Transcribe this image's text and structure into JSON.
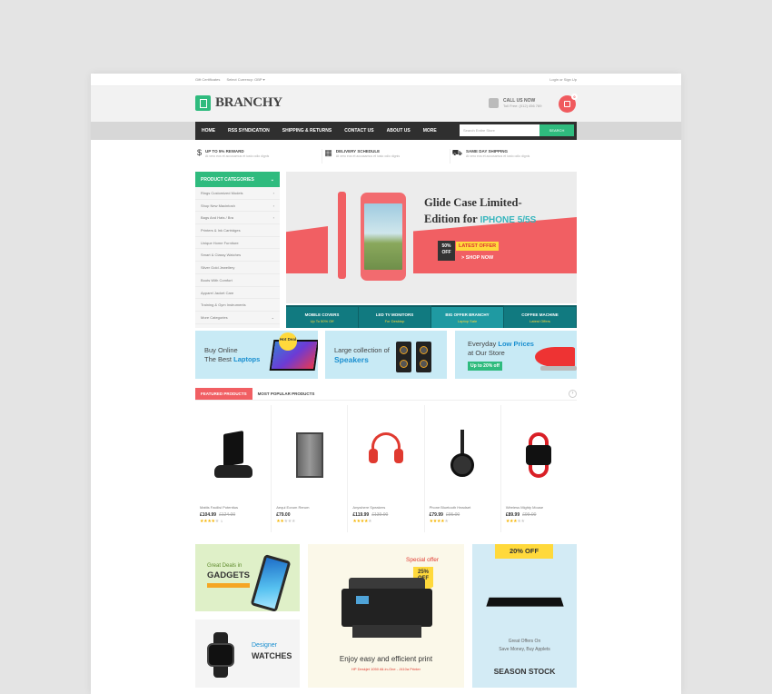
{
  "topbar": {
    "gift": "Gift Certificates",
    "currency": "Select Currency: GBP ▾",
    "login": "Login or Sign Up"
  },
  "header": {
    "logo": "BRANCHY",
    "call_title": "CALL US NOW",
    "call_sub": "Toll Free: (012) 456 789",
    "cart_count": "0"
  },
  "nav": {
    "items": [
      "HOME",
      "RSS SYNDICATION",
      "SHIPPING & RETURNS",
      "CONTACT US",
      "ABOUT US",
      "MORE"
    ],
    "search_placeholder": "Search Entire Store",
    "search_button": "SEARCH"
  },
  "features": [
    {
      "icon": "dollar-icon",
      "title": "UP TO 5% REWARD",
      "sub": "At vero eos et accusamus et iusto odio dignis"
    },
    {
      "icon": "calendar-icon",
      "title": "DELIVERY SCHEDULE",
      "sub": "At vero eos et accusamus et iusto odio dignis"
    },
    {
      "icon": "truck-icon",
      "title": "SAME DAY SHIPPING",
      "sub": "At vero eos et accusamus et iusto odio dignis"
    }
  ],
  "categories": {
    "header": "PRODUCT CATEGORIES",
    "items": [
      "Rings Customized Models",
      "Shop New Macintosh",
      "Bags And Hats / Bra",
      "Printers & Ink Cartridges",
      "Unique Home Furniture",
      "Smart & Classy Watches",
      "Silver Gold Jewellery",
      "Boots With Comfort",
      "Apparel Jacket Care",
      "Training & Gym Instruments",
      "More Categories"
    ]
  },
  "hero": {
    "title_line1": "Glide Case Limited-",
    "title_line2_a": "Edition for ",
    "title_line2_b": "IPHONE 5/5S",
    "pct_a": "50%",
    "pct_b": "OFF",
    "latest": "LATEST OFFER",
    "shop_now": "> SHOP NOW"
  },
  "hero_tabs": [
    {
      "title": "MOBILE COVERS",
      "sub": "Up To 50% Off"
    },
    {
      "title": "LED TV MONITORS",
      "sub": "For Desktop"
    },
    {
      "title": "BIG OFFER BRANCHY",
      "sub": "Laptop Sale"
    },
    {
      "title": "COFFEE MACHINE",
      "sub": "Latest Offers"
    }
  ],
  "promos": {
    "laptops": {
      "l1": "Buy Online",
      "l2a": "The Best ",
      "l2b": "Laptops",
      "hot": "Hot Deal"
    },
    "speakers": {
      "l1": "Large collection of",
      "l2": "Speakers"
    },
    "prices": {
      "l1a": "Everyday ",
      "l1b": "Low Prices",
      "l2": "at Our Store",
      "badge": "Up to 20% off"
    }
  },
  "product_tabs": [
    "FEATURED PRODUCTS",
    "MOST POPULAR PRODUCTS"
  ],
  "products": [
    {
      "name": "Mattis Facilisi Potenttus",
      "price": "£104.99",
      "old": "£124.00",
      "stars": 4,
      "count": "1"
    },
    {
      "name": "Aequi Eorum Rerum",
      "price": "£79.00",
      "old": "",
      "stars": 2,
      "count": ""
    },
    {
      "name": "Anywhere Speakers",
      "price": "£119.99",
      "old": "£139.00",
      "stars": 4,
      "count": ""
    },
    {
      "name": "Phone Bluetooth Headset",
      "price": "£79.99",
      "old": "£95.00",
      "stars": 4,
      "count": ""
    },
    {
      "name": "Wireless Mighty Mouse",
      "price": "£89.99",
      "old": "£99.00",
      "stars": 3,
      "count": ""
    }
  ],
  "banners": {
    "gadgets": {
      "l1": "Great Deals in",
      "l2": "GADGETS"
    },
    "watches": {
      "l1": "Designer",
      "l2": "WATCHES"
    },
    "printer": {
      "special": "Special offer",
      "pct": "25%",
      "off": "OFF",
      "main": "Enjoy easy and efficient print",
      "small": "HP Deskjet 1050 All-in-One - J410a Printer"
    },
    "season": {
      "off": "20% OFF",
      "l1": "Great Offers On",
      "l2": "Save Money, Buy Applets",
      "title": "SEASON STOCK"
    }
  },
  "colors": {
    "brand_green": "#2fbb7e",
    "accent_red": "#f15f63",
    "teal": "#1f9aa2",
    "yellow": "#ffd93b"
  }
}
